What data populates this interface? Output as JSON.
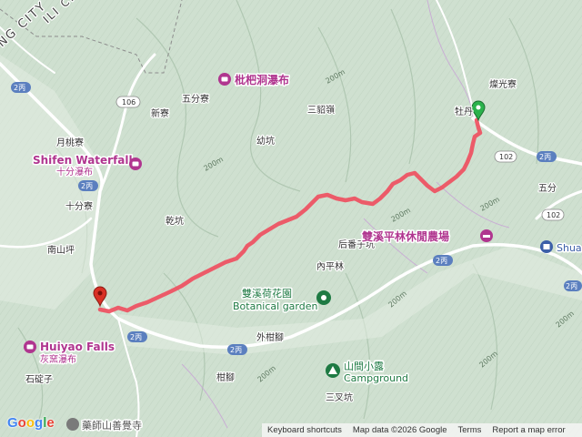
{
  "map": {
    "city_label": "NG CITY",
    "city_label_2": "ILI CITY",
    "places": {
      "canguangliao": "燦光寮",
      "mudan": "牡丹",
      "sandiaoling": "三貂嶺",
      "wufenliao": "五分寮",
      "xinliao": "新寮",
      "yuetaoliao": "月桃寮",
      "youkeng": "幼坑",
      "shifenliao": "十分寮",
      "qiankeng": "乾坑",
      "nanshanping": "南山坪",
      "wufen": "五分",
      "houfanzikeng": "后番子坑",
      "neipinglin": "內平林",
      "waigantiao": "外柑腳",
      "gantiao": "柑腳",
      "shidingzi": "石碇子",
      "sanchakeng": "三叉坑"
    },
    "pois": {
      "pipadong": "枇杷洞瀑布",
      "shifen_en": "Shifen Waterfall",
      "shifen_zh": "十分瀑布",
      "shuangxi_farm": "雙溪平林休閒農場",
      "shuangxi_garden_zh": "雙溪荷花園",
      "shuangxi_garden_en": "Botanical garden",
      "shanjian_zh": "山間小露",
      "shanjian_en": "Campground",
      "huiyao_en": "Huiyao Falls",
      "huiyao_zh": "灰窯瀑布",
      "shua": "Shua",
      "temple": "藥師山善覺寺"
    },
    "roads": {
      "r106": "106",
      "r102a": "102",
      "r102b": "102",
      "r2bing_a": "2丙",
      "r2bing_b": "2丙",
      "r2bing_c": "2丙",
      "r2bing_d": "2丙",
      "r2bing_e": "2丙",
      "r2bing_f": "2丙",
      "r2bing_g": "2丙"
    },
    "elevations": {
      "e200a": "200m",
      "e200b": "200m",
      "e200c": "200m",
      "e200d": "200m",
      "e200e": "200m",
      "e200f": "200m",
      "e200g": "200m",
      "e200h": "200m"
    },
    "colors": {
      "route": "#ef4f5f",
      "start_marker": "#2bb24c",
      "end_marker": "#d93025",
      "road": "#ffffff",
      "terrain": "#cfe0d0"
    }
  },
  "branding": {
    "logo": "Google"
  },
  "footer": {
    "shortcuts": "Keyboard shortcuts",
    "map_data": "Map data ©2026 Google",
    "terms": "Terms",
    "report": "Report a map error"
  }
}
